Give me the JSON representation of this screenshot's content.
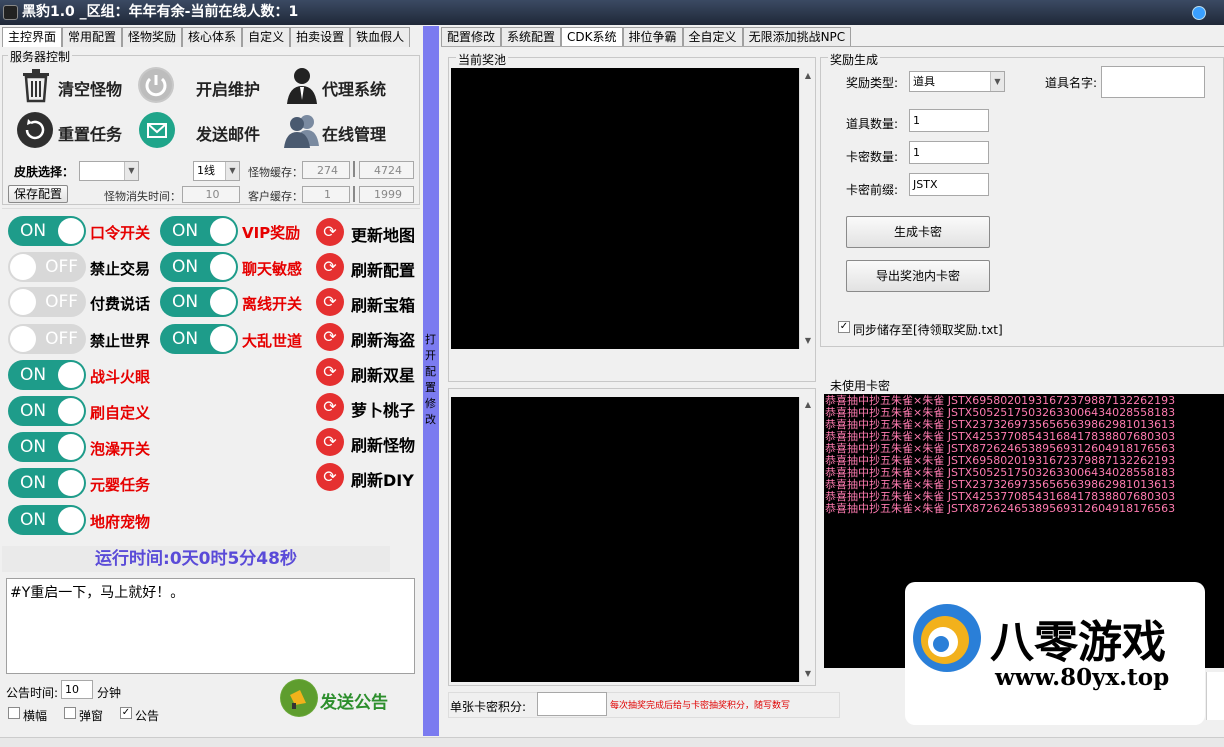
{
  "window": {
    "title": "黑豹1.0 _区组：年年有余-当前在线人数：1"
  },
  "left_tabs": [
    "主控界面",
    "常用配置",
    "怪物奖励",
    "核心体系",
    "自定义",
    "拍卖设置",
    "铁血假人"
  ],
  "server_control": {
    "group_label": "服务器控制",
    "buttons": {
      "clear_monsters": "清空怪物",
      "maintenance": "开启维护",
      "agent_system": "代理系统",
      "reset_tasks": "重置任务",
      "send_mail": "发送邮件",
      "online_manage": "在线管理"
    },
    "skin_label": "皮肤选择：",
    "line_value": "1线",
    "monster_cache_label": "怪物缓存：",
    "monster_cache_a": "274",
    "monster_cache_b": "4724",
    "save_config": "保存配置",
    "monster_vanish_label": "怪物消失时间：",
    "monster_vanish_value": "10",
    "client_cache_label": "客户缓存：",
    "client_cache_a": "1",
    "client_cache_b": "1999"
  },
  "toggles_col1": [
    {
      "state": "ON",
      "label": "口令开关",
      "color": "red"
    },
    {
      "state": "OFF",
      "label": "禁止交易",
      "color": "black"
    },
    {
      "state": "OFF",
      "label": "付费说话",
      "color": "black"
    },
    {
      "state": "OFF",
      "label": "禁止世界",
      "color": "black"
    },
    {
      "state": "ON",
      "label": "战斗火眼",
      "color": "red"
    },
    {
      "state": "ON",
      "label": "刷自定义",
      "color": "red"
    },
    {
      "state": "ON",
      "label": "泡澡开关",
      "color": "red"
    },
    {
      "state": "ON",
      "label": "元婴任务",
      "color": "red"
    },
    {
      "state": "ON",
      "label": "地府宠物",
      "color": "red"
    }
  ],
  "toggles_col2": [
    {
      "state": "ON",
      "label": "VIP奖励"
    },
    {
      "state": "ON",
      "label": "聊天敏感"
    },
    {
      "state": "ON",
      "label": "离线开关"
    },
    {
      "state": "ON",
      "label": "大乱世道"
    }
  ],
  "refresh_buttons": [
    "更新地图",
    "刷新配置",
    "刷新宝箱",
    "刷新海盗",
    "刷新双星",
    "萝卜桃子",
    "刷新怪物",
    "刷新DIY"
  ],
  "runtime": "运行时间:0天0时5分48秒",
  "announcement": {
    "text": "#Y重启一下，马上就好！。",
    "time_label": "公告时间:",
    "time_value": "10",
    "time_unit": "分钟",
    "send_label": "发送公告",
    "checks": [
      {
        "label": "横幅",
        "checked": false
      },
      {
        "label": "弹窗",
        "checked": false
      },
      {
        "label": "公告",
        "checked": true
      }
    ]
  },
  "splitter_text": "打开配置修改",
  "right_tabs": [
    "配置修改",
    "系统配置",
    "CDK系统",
    "排位争霸",
    "全自定义",
    "无限添加挑战NPC"
  ],
  "prize_pool_label": "当前奖池",
  "reward": {
    "group_label": "奖励生成",
    "type_label": "奖励类型:",
    "type_value": "道具",
    "name_label": "道具名字:",
    "qty_label": "道具数量:",
    "qty_value": "1",
    "card_qty_label": "卡密数量:",
    "card_qty_value": "1",
    "prefix_label": "卡密前缀:",
    "prefix_value": "JSTX",
    "generate_button": "生成卡密",
    "export_button": "导出奖池内卡密",
    "sync_label": "同步储存至[待领取奖励.txt]"
  },
  "unused_label": "未使用卡密",
  "unused_cards": [
    "恭喜抽中抄五朱雀×朱雀 JSTX69580201931672379887132262193",
    "恭喜抽中抄五朱雀×朱雀 JSTX50525175032633006434028558183",
    "恭喜抽中抄五朱雀×朱雀 JSTX23732697356565639862981013613",
    "恭喜抽中抄五朱雀×朱雀 JSTX42537708543168417838807680303",
    "恭喜抽中抄五朱雀×朱雀 JSTX87262465389569312604918176563",
    "恭喜抽中抄五朱雀×朱雀 JSTX69580201931672379887132262193",
    "恭喜抽中抄五朱雀×朱雀 JSTX50525175032633006434028558183",
    "恭喜抽中抄五朱雀×朱雀 JSTX23732697356565639862981013613",
    "恭喜抽中抄五朱雀×朱雀 JSTX42537708543168417838807680303",
    "恭喜抽中抄五朱雀×朱雀 JSTX87262465389569312604918176563"
  ],
  "single_points_label": "单张卡密积分:",
  "single_points_hint": "每次抽奖完成后给与卡密抽奖积分，随写数写",
  "watermark": {
    "brand": "八零游戏",
    "url": "www.80yx.top"
  }
}
